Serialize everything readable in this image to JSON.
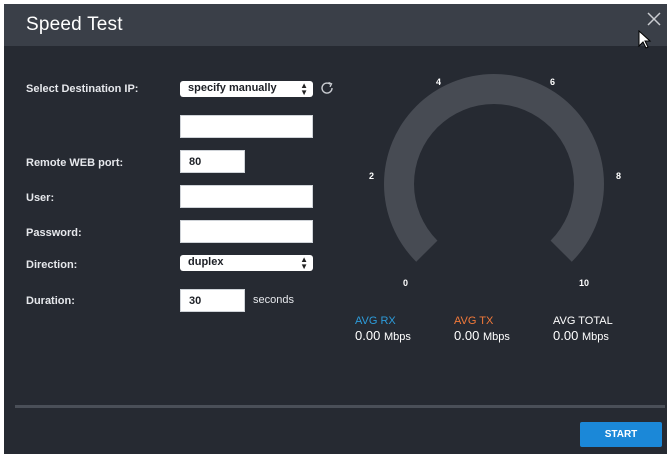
{
  "dialog": {
    "title": "Speed Test"
  },
  "form": {
    "destination": {
      "label": "Select Destination IP:",
      "selected": "specify manually",
      "ip_value": ""
    },
    "port": {
      "label": "Remote WEB port:",
      "value": "80"
    },
    "user": {
      "label": "User:",
      "value": ""
    },
    "password": {
      "label": "Password:",
      "value": ""
    },
    "direction": {
      "label": "Direction:",
      "selected": "duplex"
    },
    "duration": {
      "label": "Duration:",
      "value": "30",
      "unit": "seconds"
    }
  },
  "gauge": {
    "ticks": [
      "0",
      "2",
      "4",
      "6",
      "8",
      "10"
    ],
    "value": 0
  },
  "stats": {
    "rx": {
      "label": "AVG RX",
      "value": "0.00",
      "unit": "Mbps",
      "color": "#2d9cdb"
    },
    "tx": {
      "label": "AVG TX",
      "value": "0.00",
      "unit": "Mbps",
      "color": "#f2793a"
    },
    "total": {
      "label": "AVG TOTAL",
      "value": "0.00",
      "unit": "Mbps",
      "color": "#ffffff"
    }
  },
  "footer": {
    "start_label": "START"
  },
  "icons": [
    "close-icon",
    "refresh-icon",
    "mouse-cursor-icon",
    "select-arrows-icon"
  ]
}
